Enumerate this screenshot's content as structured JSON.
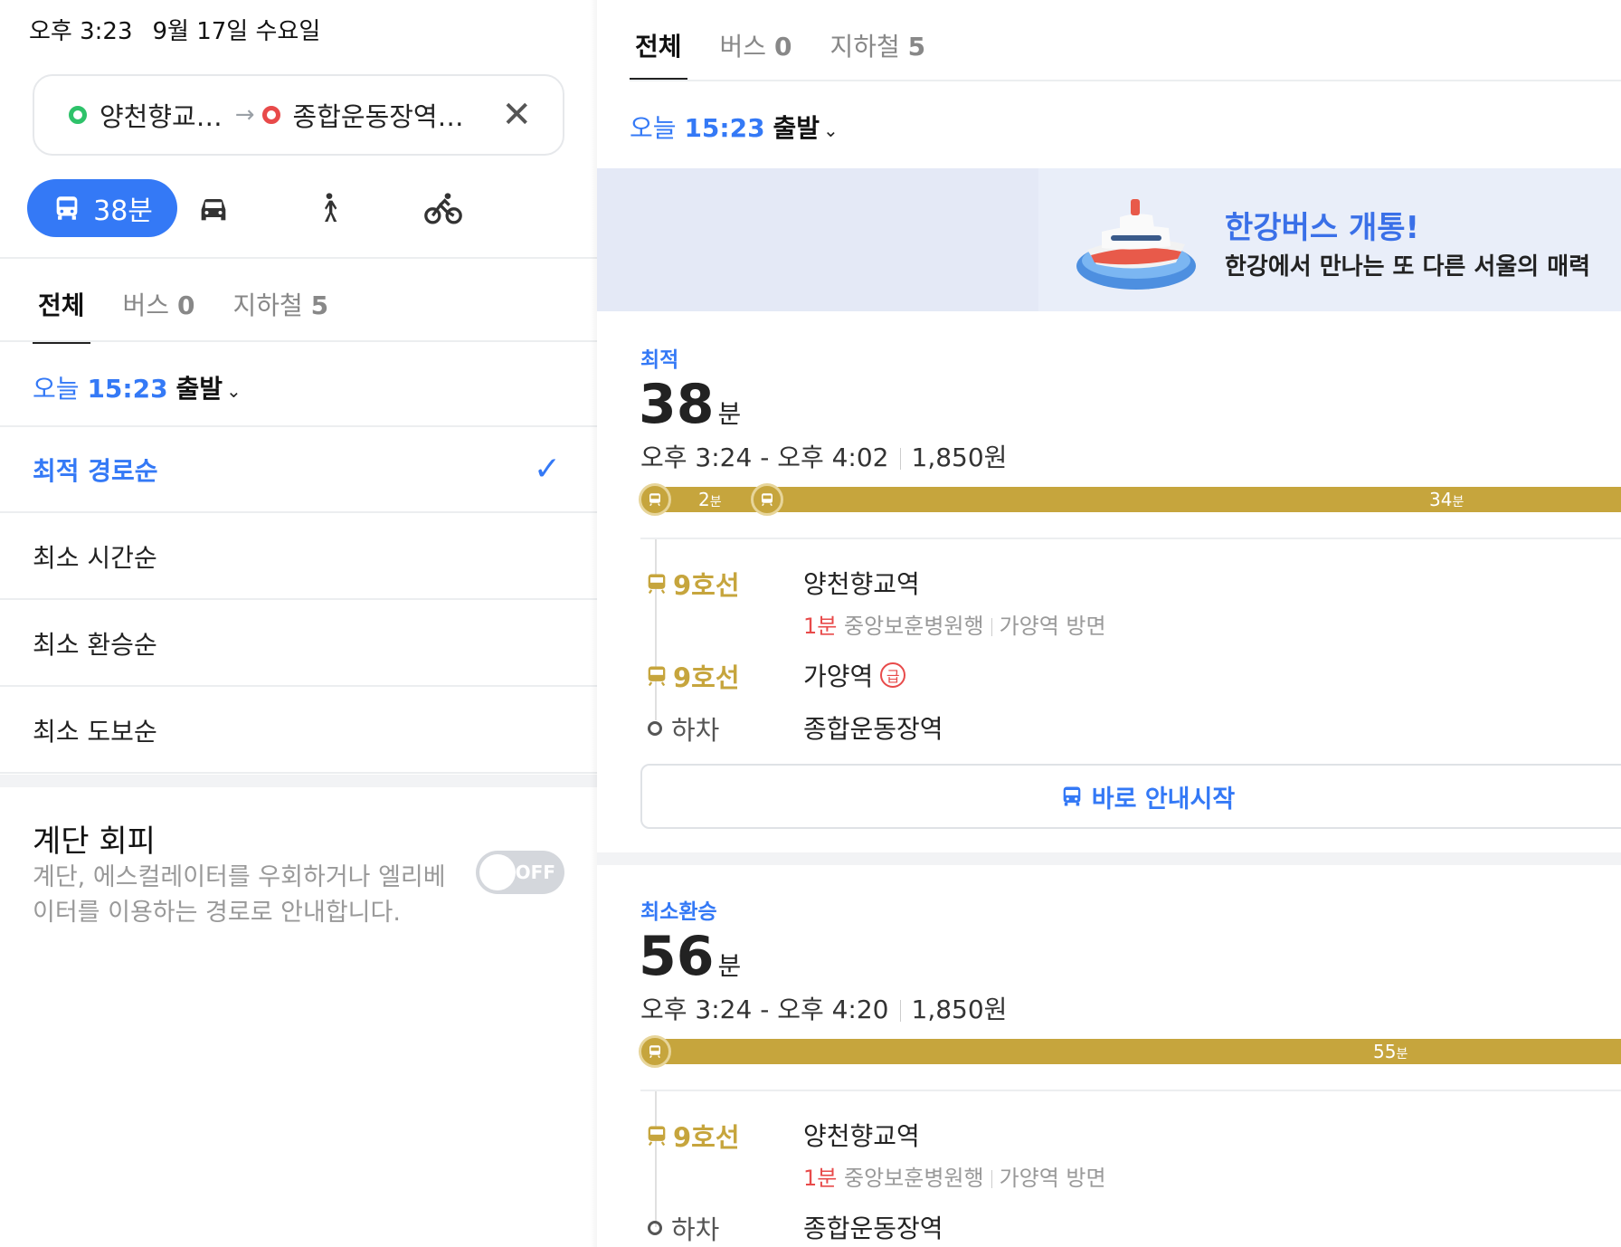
{
  "status_bar": {
    "time": "오후 3:23",
    "date": "9월 17일 수요일"
  },
  "search": {
    "origin": "양천향교…",
    "destination": "종합운동장역…"
  },
  "modes": {
    "transit_label": "38분"
  },
  "tabs": [
    {
      "label": "전체",
      "count": ""
    },
    {
      "label": "버스",
      "count": "0"
    },
    {
      "label": "지하철",
      "count": "5"
    }
  ],
  "departure": {
    "prefix": "오늘",
    "time": "15:23",
    "suffix": "출발"
  },
  "sort_options": [
    "최적 경로순",
    "최소 시간순",
    "최소 환승순",
    "최소 도보순"
  ],
  "stairs": {
    "title": "계단 회피",
    "description": "계단, 에스컬레이터를 우회하거나 엘리베이터를 이용하는 경로로 안내합니다.",
    "toggle": "OFF"
  },
  "banner": {
    "title": "한강버스 개통!",
    "subtitle": "한강에서 만나는 또 다른 서울의 매력"
  },
  "routes": [
    {
      "tag": "최적",
      "minutes": "38",
      "unit": "분",
      "time_range": "오후 3:24 - 오후 4:02",
      "fare": "1,850원",
      "segments": [
        {
          "minutes": "2",
          "unit": "분"
        },
        {
          "minutes": "34",
          "unit": "분"
        }
      ],
      "steps": [
        {
          "line": "9호선",
          "station": "양천향교역",
          "wait": "1분",
          "bound": "중앙보훈병원행",
          "direction": "가양역 방면"
        },
        {
          "line": "9호선",
          "station": "가양역",
          "badge": "급"
        },
        {
          "line": "하차",
          "station": "종합운동장역"
        }
      ],
      "button": "바로 안내시작"
    },
    {
      "tag": "최소환승",
      "minutes": "56",
      "unit": "분",
      "time_range": "오후 3:24 - 오후 4:20",
      "fare": "1,850원",
      "segments": [
        {
          "minutes": "55",
          "unit": "분"
        }
      ],
      "steps": [
        {
          "line": "9호선",
          "station": "양천향교역",
          "wait": "1분",
          "bound": "중앙보훈병원행",
          "direction": "가양역 방면"
        },
        {
          "line": "하차",
          "station": "종합운동장역"
        }
      ]
    }
  ],
  "colors": {
    "accent": "#3479f6",
    "line9": "#c6a53d",
    "red": "#e84a4a"
  },
  "icons": [
    "bus-icon",
    "car-icon",
    "walk-icon",
    "bike-icon",
    "close-icon",
    "chevron-down-icon",
    "check-icon",
    "subway-icon",
    "boat-icon"
  ]
}
